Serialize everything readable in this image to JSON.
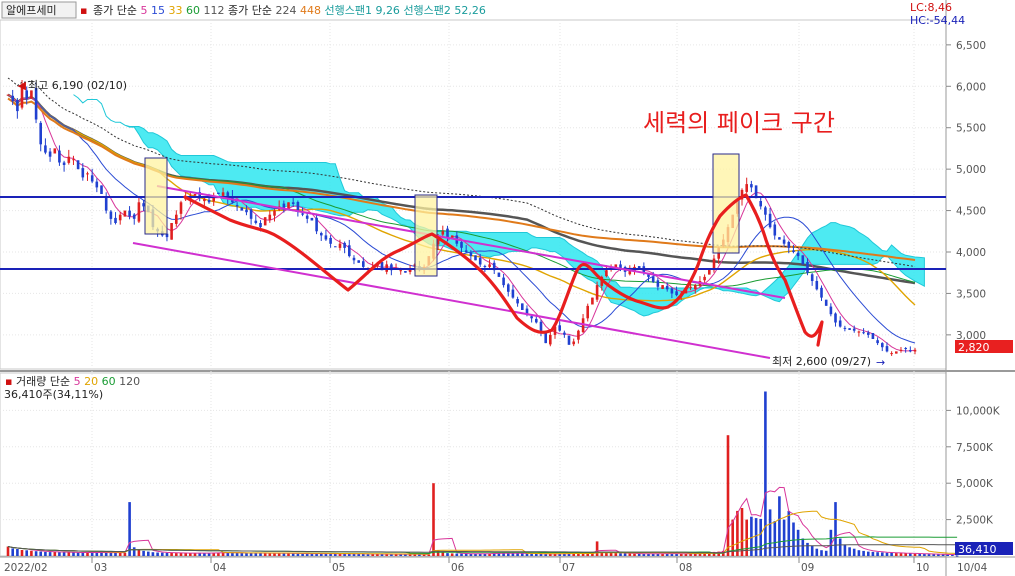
{
  "header": {
    "stock_name": "알에프세미",
    "ma_title": "종가 단순",
    "ma_periods": [
      {
        "label": "5",
        "color": "#d8369a"
      },
      {
        "label": "15",
        "color": "#2b4bd4"
      },
      {
        "label": "33",
        "color": "#e0a400"
      },
      {
        "label": "60",
        "color": "#1a9c34"
      },
      {
        "label": "112",
        "color": "#555555"
      }
    ],
    "ma2_title": "종가 단순",
    "ma2_periods": [
      {
        "label": "224",
        "color": "#555555"
      },
      {
        "label": "448",
        "color": "#e07a1a"
      }
    ],
    "span1": "선행스팬1 9,26",
    "span2": "선행스팬2 52,26",
    "lc": "LC:8,46",
    "hc": "HC:-54,44"
  },
  "annotations": {
    "high": "최고 6,190 (02/10)",
    "low": "최저 2,600 (09/27)",
    "fake_zone": "세력의 페이크 구간",
    "current_price": "2,820"
  },
  "volume_header": {
    "title": "거래량",
    "ma_title": "단순",
    "periods": [
      {
        "label": "5",
        "color": "#d8369a"
      },
      {
        "label": "20",
        "color": "#e0a400"
      },
      {
        "label": "60",
        "color": "#1a9c34"
      },
      {
        "label": "120",
        "color": "#555555"
      }
    ],
    "value": "36,410주(34,11%)",
    "current": "36,410"
  },
  "price_axis": [
    "6,500",
    "6,000",
    "5,500",
    "5,000",
    "4,500",
    "4,000",
    "3,500",
    "3,000"
  ],
  "volume_axis": [
    "10,000K",
    "7,500K",
    "5,000K",
    "2,500K"
  ],
  "x_axis": [
    "2022/02",
    "03",
    "04",
    "05",
    "06",
    "07",
    "08",
    "09",
    "10",
    "10/04"
  ],
  "chart_data": {
    "type": "candlestick",
    "ylim": [
      2600,
      6800
    ],
    "volume_ylim": [
      0,
      12500
    ],
    "closes": [
      5900,
      5820,
      5700,
      5980,
      5850,
      5950,
      5600,
      5300,
      5200,
      5150,
      5250,
      5080,
      5050,
      5150,
      5120,
      5000,
      4900,
      4950,
      4850,
      4780,
      4700,
      4500,
      4400,
      4350,
      4450,
      4500,
      4430,
      4400,
      4600,
      4550,
      4480,
      4300,
      4250,
      4200,
      4180,
      4350,
      4450,
      4600,
      4650,
      4680,
      4700,
      4650,
      4640,
      4600,
      4680,
      4700,
      4720,
      4650,
      4600,
      4550,
      4500,
      4480,
      4400,
      4350,
      4300,
      4420,
      4450,
      4500,
      4550,
      4530,
      4600,
      4580,
      4500,
      4450,
      4400,
      4380,
      4250,
      4200,
      4150,
      4100,
      4060,
      4100,
      4050,
      3950,
      3900,
      3870,
      3820,
      3800,
      3820,
      3850,
      3780,
      3850,
      3780,
      3800,
      3780,
      3750,
      3800,
      3850,
      3780,
      3820,
      3950,
      4100,
      4200,
      4250,
      4180,
      4200,
      4100,
      4050,
      4000,
      3950,
      3900,
      3850,
      3820,
      3850,
      3780,
      3700,
      3600,
      3520,
      3450,
      3380,
      3300,
      3250,
      3200,
      3150,
      3020,
      2900,
      3000,
      3100,
      3050,
      3000,
      2880,
      2920,
      3050,
      3200,
      3350,
      3450,
      3600,
      3700,
      3780,
      3820,
      3850,
      3800,
      3760,
      3780,
      3820,
      3800,
      3750,
      3700,
      3640,
      3580,
      3600,
      3550,
      3500,
      3480,
      3500,
      3550,
      3580,
      3600,
      3650,
      3700,
      3800,
      3920,
      4050,
      4150,
      4300,
      4450,
      4600,
      4750,
      4820,
      4780,
      4650,
      4550,
      4450,
      4300,
      4200,
      4150,
      4100,
      4050,
      4000,
      3950,
      3850,
      3750,
      3650,
      3550,
      3450,
      3350,
      3250,
      3150,
      3100,
      3080,
      3060,
      3050,
      3040,
      3020,
      3000,
      2950,
      2900,
      2850,
      2800,
      2780,
      2800,
      2820,
      2830,
      2800,
      2820
    ],
    "volumes": [
      650,
      520,
      480,
      410,
      390,
      360,
      330,
      300,
      280,
      270,
      300,
      260,
      250,
      270,
      240,
      230,
      220,
      260,
      250,
      230,
      240,
      220,
      230,
      250,
      240,
      210,
      3700,
      600,
      450,
      350,
      300,
      260,
      240,
      230,
      220,
      210,
      200,
      210,
      200,
      190,
      200,
      210,
      200,
      190,
      220,
      230,
      260,
      240,
      230,
      210,
      200,
      190,
      200,
      220,
      210,
      190,
      180,
      170,
      190,
      200,
      180,
      170,
      160,
      150,
      170,
      180,
      160,
      150,
      170,
      160,
      150,
      140,
      160,
      170,
      150,
      140,
      130,
      120,
      140,
      150,
      130,
      120,
      110,
      130,
      140,
      120,
      110,
      100,
      120,
      110,
      100,
      5000,
      400,
      260,
      200,
      180,
      170,
      160,
      150,
      140,
      150,
      160,
      170,
      180,
      200,
      190,
      180,
      170,
      190,
      200,
      180,
      170,
      160,
      150,
      140,
      130,
      140,
      150,
      160,
      170,
      180,
      190,
      200,
      210,
      200,
      190,
      1000,
      300,
      250,
      220,
      200,
      190,
      180,
      170,
      160,
      150,
      140,
      150,
      160,
      170,
      180,
      170,
      160,
      150,
      140,
      150,
      160,
      180,
      200,
      220,
      250,
      280,
      300,
      350,
      8300,
      2500,
      3100,
      3300,
      2500,
      2700,
      2600,
      2550,
      11300,
      3200,
      2400,
      4100,
      2500,
      3100,
      2300,
      1800,
      1200,
      900,
      700,
      500,
      400,
      360,
      1800,
      3700,
      1200,
      800,
      600,
      500,
      400,
      350,
      300,
      280,
      260,
      240,
      220,
      210,
      200,
      190,
      180,
      170,
      160,
      150,
      140,
      130,
      120,
      110,
      100,
      90,
      80,
      36
    ]
  }
}
